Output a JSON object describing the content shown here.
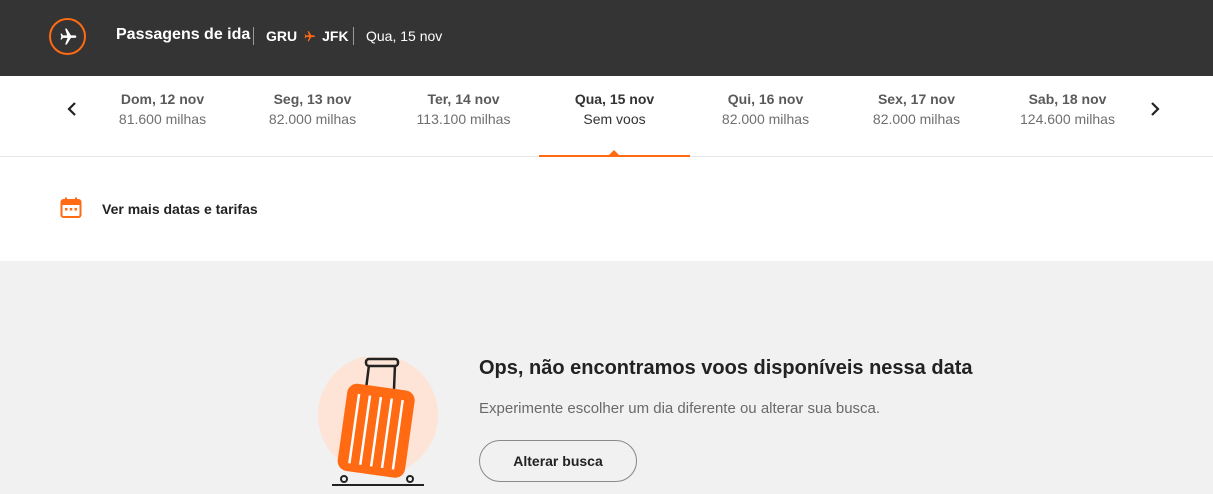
{
  "header": {
    "title": "Passagens de ida",
    "origin": "GRU",
    "destination": "JFK",
    "date": "Qua, 15 nov"
  },
  "date_tabs": [
    {
      "day": "Dom, 12 nov",
      "miles": "81.600 milhas"
    },
    {
      "day": "Seg, 13 nov",
      "miles": "82.000 milhas"
    },
    {
      "day": "Ter, 14 nov",
      "miles": "113.100 milhas"
    },
    {
      "day": "Qua, 15 nov",
      "miles": "Sem voos"
    },
    {
      "day": "Qui, 16 nov",
      "miles": "82.000 milhas"
    },
    {
      "day": "Sex, 17 nov",
      "miles": "82.000 milhas"
    },
    {
      "day": "Sab, 18 nov",
      "miles": "124.600 milhas"
    }
  ],
  "more_dates": {
    "label": "Ver mais datas e tarifas"
  },
  "empty_state": {
    "title": "Ops, não encontramos voos disponíveis nessa data",
    "subtitle": "Experimente escolher um dia diferente ou alterar sua busca.",
    "button_label": "Alterar busca"
  },
  "colors": {
    "accent": "#ff6a13",
    "header_bg": "#343434"
  }
}
